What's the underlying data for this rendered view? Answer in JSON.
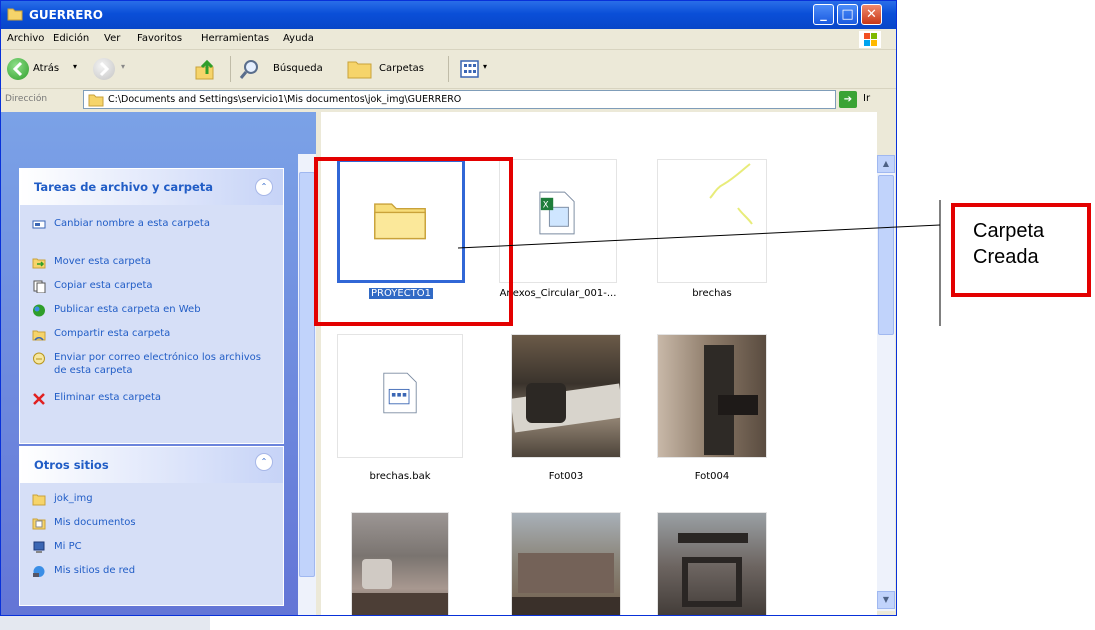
{
  "window": {
    "title": "GUERRERO"
  },
  "menu": [
    "Archivo",
    "Edición",
    "Ver",
    "Favoritos",
    "Herramientas",
    "Ayuda"
  ],
  "toolbar": {
    "back_label": "Atrás",
    "search_label": "Búsqueda",
    "folders_label": "Carpetas"
  },
  "address": {
    "label": "Dirección",
    "path": "C:\\Documents and Settings\\servicio1\\Mis documentos\\jok_img\\GUERRERO",
    "go_label": "Ir"
  },
  "tasks_panel": {
    "title": "Tareas de archivo y carpeta",
    "items": [
      {
        "label": "Canbiar nombre a esta carpeta",
        "icon": "rename-icon"
      },
      {
        "label": "Mover esta carpeta",
        "icon": "move-icon"
      },
      {
        "label": "Copiar esta carpeta",
        "icon": "copy-icon"
      },
      {
        "label": "Publicar esta carpeta en Web",
        "icon": "web-publish-icon"
      },
      {
        "label": "Compartir esta carpeta",
        "icon": "share-icon"
      },
      {
        "label": "Enviar por correo electrónico los archivos de esta carpeta",
        "icon": "email-icon"
      },
      {
        "label": "Eliminar esta carpeta",
        "icon": "delete-icon"
      }
    ]
  },
  "places_panel": {
    "title": "Otros sitios",
    "items": [
      {
        "label": "jok_img",
        "icon": "folder-icon"
      },
      {
        "label": "Mis documentos",
        "icon": "documents-icon"
      },
      {
        "label": "Mi PC",
        "icon": "computer-icon"
      },
      {
        "label": "Mis sitios de red",
        "icon": "network-icon"
      }
    ]
  },
  "files": [
    {
      "name": "PROYECTO1",
      "type": "folder",
      "selected": true
    },
    {
      "name": "Anexos_Circular_001-...",
      "type": "excel"
    },
    {
      "name": "brechas",
      "type": "image"
    },
    {
      "name": "brechas.bak",
      "type": "file"
    },
    {
      "name": "Fot003",
      "type": "photo"
    },
    {
      "name": "Fot004",
      "type": "photo"
    },
    {
      "name": "",
      "type": "photo"
    },
    {
      "name": "",
      "type": "photo"
    },
    {
      "name": "",
      "type": "photo"
    }
  ],
  "annotation": {
    "label": "Carpeta Creada",
    "color": "#e30000"
  },
  "colors": {
    "titlebar": "#0a4fd8",
    "panel": "#6375d6",
    "selection": "#316ac5",
    "link": "#215dc6"
  }
}
